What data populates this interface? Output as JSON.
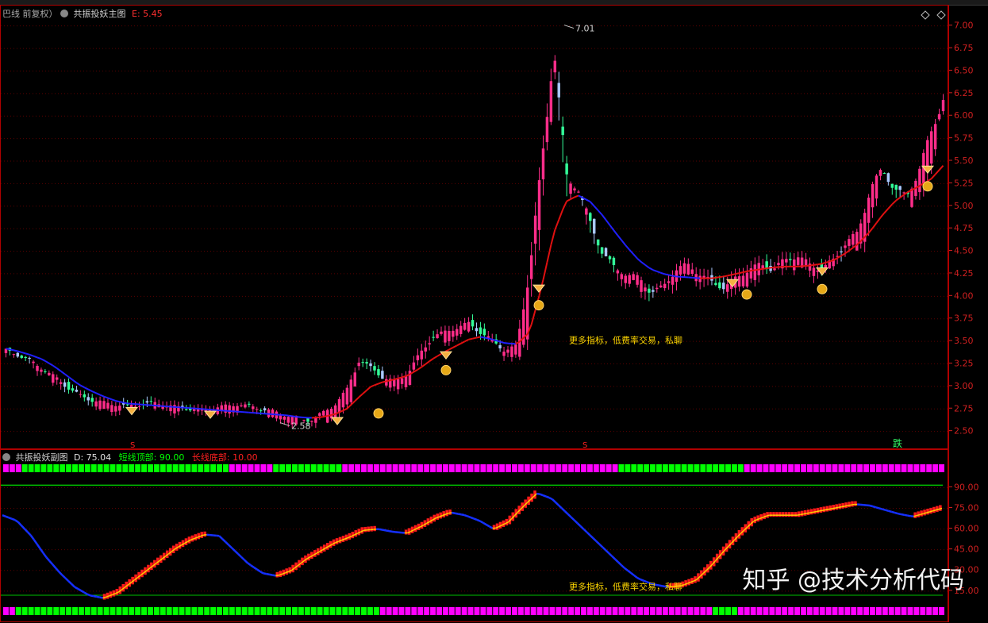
{
  "main_header": {
    "prefix": "巴线 前复权）",
    "name": "共振投妖主图",
    "e_label": "E: 5.45"
  },
  "sub_header": {
    "name": "共振投妖副图",
    "d_label": "D: 75.04",
    "short_label": "短线顶部: 90.00",
    "long_label": "长线底部: 10.00"
  },
  "annotations": {
    "high_price": "7.01",
    "low_price": "2.58",
    "promo_main": "更多指标，低费率交易，私聊",
    "promo_sub": "更多指标，低费率交易，私聊",
    "fall_label": "跌",
    "s_marker": "S"
  },
  "watermark": "知乎 @技术分析代码",
  "colors": {
    "up": "#ff2d8a",
    "down": "#33ff99",
    "down_blue": "#aac8ff",
    "ma_red": "#e01010",
    "ma_blue": "#2020ff",
    "grid": "#5a0000",
    "axis_text": "#d02020",
    "bar_green": "#00ff00",
    "bar_magenta": "#ff00ff"
  },
  "chart_data": [
    {
      "type": "candlestick",
      "ylim": [
        2.4,
        7.05
      ],
      "y_ticks": [
        "7.00",
        "6.75",
        "6.50",
        "6.25",
        "6.00",
        "5.75",
        "5.50",
        "5.25",
        "5.00",
        "4.75",
        "4.50",
        "4.25",
        "4.00",
        "3.75",
        "3.50",
        "3.25",
        "3.00",
        "2.75",
        "2.50"
      ],
      "close_path": [
        3.4,
        3.35,
        3.28,
        3.2,
        3.1,
        3.0,
        2.9,
        2.85,
        2.82,
        2.8,
        2.78,
        2.8,
        2.82,
        2.8,
        2.77,
        2.75,
        2.74,
        2.76,
        2.78,
        2.8,
        2.78,
        2.75,
        2.72,
        2.68,
        2.65,
        2.62,
        2.7,
        2.8,
        2.95,
        3.3,
        3.2,
        3.1,
        3.05,
        3.15,
        3.35,
        3.55,
        3.6,
        3.65,
        3.7,
        3.6,
        3.5,
        3.4,
        3.45,
        4.3,
        5.4,
        6.8,
        5.3,
        5.2,
        4.8,
        4.5,
        4.3,
        4.25,
        4.2,
        4.05,
        4.1,
        4.3,
        4.35,
        4.25,
        4.15,
        4.1,
        4.2,
        4.3,
        4.35,
        4.3,
        4.4,
        4.45,
        4.35,
        4.3,
        4.4,
        4.6,
        4.7,
        5.2,
        5.4,
        5.2,
        5.1,
        5.4,
        5.8,
        6.2
      ],
      "ma_path": [
        3.42,
        3.39,
        3.35,
        3.3,
        3.22,
        3.12,
        3.02,
        2.95,
        2.89,
        2.84,
        2.81,
        2.8,
        2.79,
        2.78,
        2.77,
        2.76,
        2.75,
        2.74,
        2.73,
        2.72,
        2.71,
        2.7,
        2.69,
        2.68,
        2.66,
        2.65,
        2.66,
        2.69,
        2.75,
        2.88,
        3.0,
        3.05,
        3.08,
        3.12,
        3.2,
        3.3,
        3.38,
        3.45,
        3.52,
        3.55,
        3.52,
        3.48,
        3.47,
        3.6,
        4.1,
        4.7,
        5.05,
        5.12,
        5.05,
        4.9,
        4.72,
        4.55,
        4.4,
        4.3,
        4.25,
        4.22,
        4.21,
        4.2,
        4.2,
        4.22,
        4.25,
        4.28,
        4.3,
        4.32,
        4.33,
        4.33,
        4.34,
        4.36,
        4.4,
        4.48,
        4.58,
        4.72,
        4.9,
        5.05,
        5.15,
        5.22,
        5.3,
        5.45
      ],
      "high": 7.01,
      "low": 2.58
    },
    {
      "type": "line",
      "ylim": [
        8,
        100
      ],
      "y_ticks": [
        "90.00",
        "75.00",
        "60.00",
        "45.00",
        "30.00",
        "15.00"
      ],
      "series": [
        {
          "values": [
            70,
            66,
            55,
            40,
            28,
            18,
            12,
            10,
            14,
            22,
            30,
            38,
            46,
            52,
            56,
            55,
            45,
            35,
            28,
            26,
            30,
            38,
            44,
            50,
            54,
            59,
            60,
            58,
            57,
            62,
            68,
            72,
            70,
            66,
            60,
            65,
            76,
            86,
            82,
            72,
            62,
            52,
            42,
            32,
            24,
            20,
            18,
            19,
            23,
            33,
            45,
            56,
            66,
            70,
            70,
            70,
            72,
            74,
            76,
            78,
            77,
            74,
            71,
            69,
            72,
            75
          ]
        }
      ],
      "levels": [
        90,
        75,
        60,
        45,
        30,
        15
      ]
    }
  ]
}
